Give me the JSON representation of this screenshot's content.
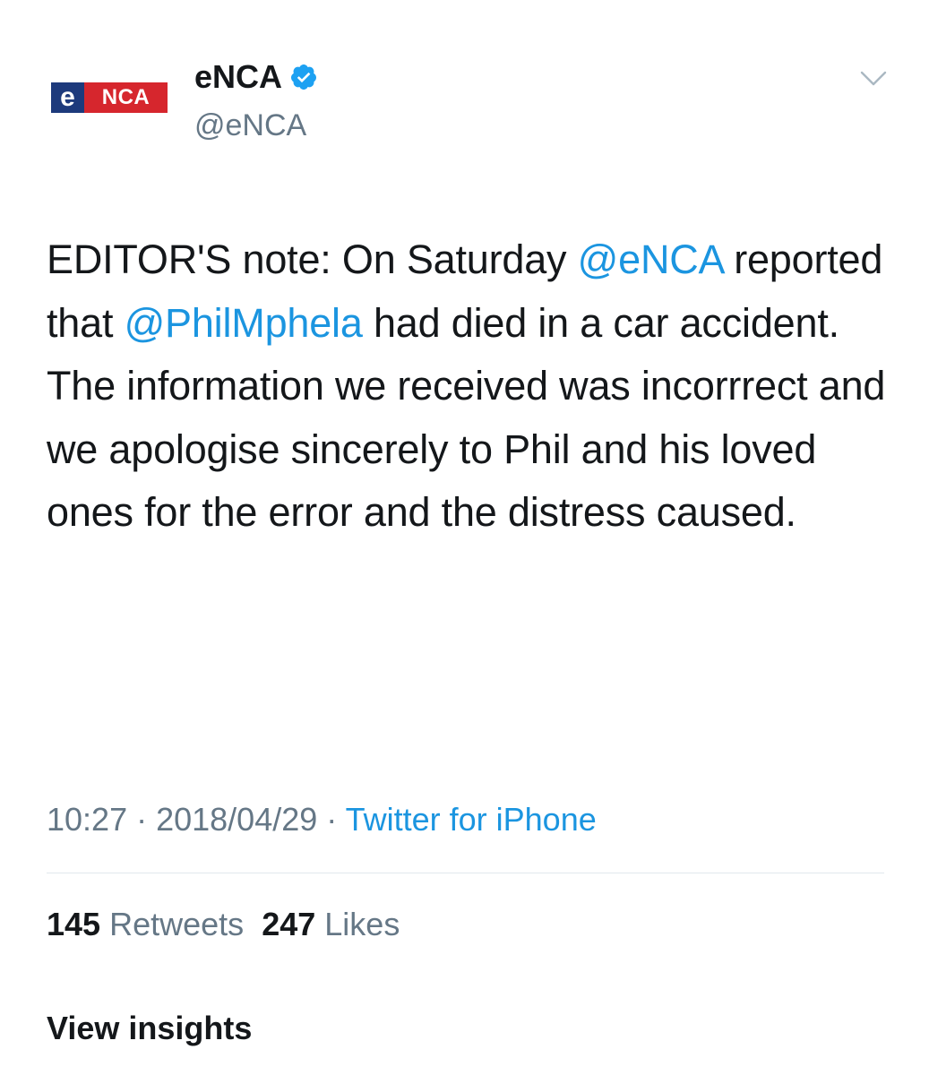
{
  "account": {
    "logo_e": "e",
    "logo_rest": "NCA",
    "display_name": "eNCA",
    "handle": "@eNCA",
    "verified_icon": "verified-badge-icon",
    "menu_icon": "chevron-down-icon"
  },
  "tweet": {
    "segments": [
      {
        "text": "EDITOR'S note: On Saturday ",
        "type": "text"
      },
      {
        "text": "@eNCA",
        "type": "mention"
      },
      {
        "text": " reported that ",
        "type": "text"
      },
      {
        "text": "@PhilMphela",
        "type": "mention"
      },
      {
        "text": " had died in a car accident. The information we received was incorrrect and we apologise sincerely to Phil and his loved ones for the error and the distress caused.",
        "type": "text"
      }
    ]
  },
  "meta": {
    "time": "10:27",
    "separator": " · ",
    "date": "2018/04/29",
    "source": "Twitter for iPhone"
  },
  "stats": {
    "retweets_count": "145",
    "retweets_label": "Retweets",
    "likes_count": "247",
    "likes_label": "Likes"
  },
  "actions": {
    "insights_label": "View insights"
  },
  "colors": {
    "link": "#1b95e0",
    "secondary": "#657786",
    "primary": "#14171a",
    "logo_blue": "#1d3a7c",
    "logo_red": "#d6262d"
  }
}
